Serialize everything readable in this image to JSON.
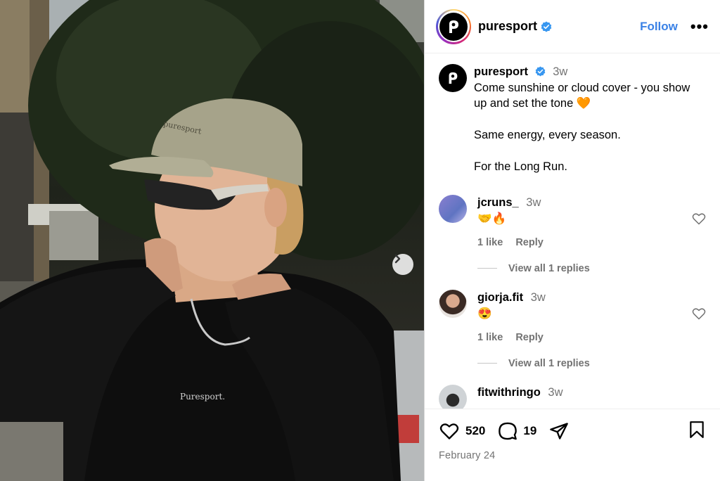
{
  "header": {
    "username": "puresport",
    "follow_label": "Follow",
    "more_label": "•••"
  },
  "caption": {
    "username": "puresport",
    "time": "3w",
    "text": "Come sunshine or cloud cover - you show up and set the tone 🧡\n\nSame energy, every season.\n\nFor the Long Run."
  },
  "shirt_text": "Puresport.",
  "cap_text": "puresport",
  "comments": [
    {
      "username": "jcruns_",
      "time": "3w",
      "text": "🤝🔥",
      "likes": "1 like",
      "reply": "Reply",
      "view_replies": "View all 1 replies"
    },
    {
      "username": "giorja.fit",
      "time": "3w",
      "text": "😍",
      "likes": "1 like",
      "reply": "Reply",
      "view_replies": "View all 1 replies"
    },
    {
      "username": "fitwithringo",
      "time": "3w"
    }
  ],
  "actions": {
    "likes_count": "520",
    "comments_count": "19",
    "date": "February 24"
  },
  "colors": {
    "follow": "#3b82e6",
    "muted": "#737373",
    "verified": "#3897f0"
  }
}
